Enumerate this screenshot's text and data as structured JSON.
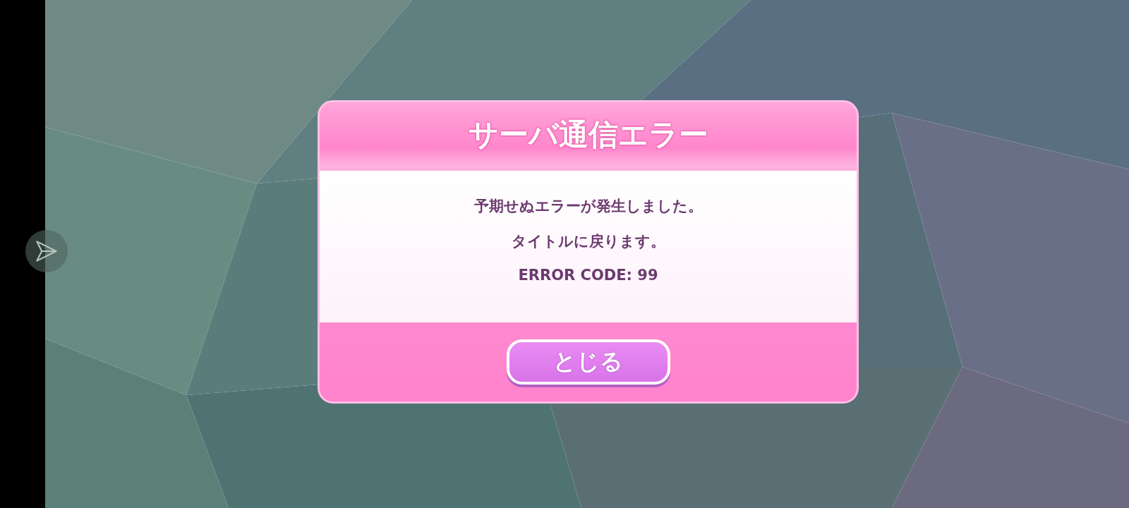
{
  "dialog": {
    "title": "サーバ通信エラー",
    "messages": [
      "予期せぬエラーが発生しました。",
      "タイトルに戻ります。",
      "ERROR CODE: 99"
    ],
    "button": "とじる"
  }
}
